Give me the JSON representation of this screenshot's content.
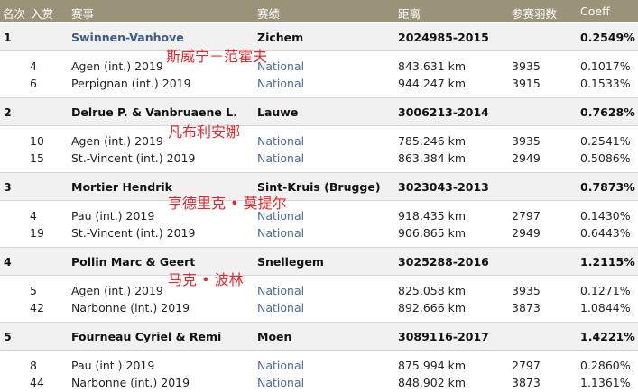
{
  "header": {
    "rank": "名次",
    "prize": "入赏",
    "race": "赛事",
    "result": "赛绩",
    "distance": "距离",
    "participants": "参赛羽数",
    "coeff": "Coeff"
  },
  "groups": [
    {
      "rank": "1",
      "name": "Swinnen-Vanhove",
      "city": "Zichem",
      "ring": "2024985-2015",
      "coeff": "0.2549%",
      "cn": "斯威宁－范霍夫",
      "rows": [
        {
          "prize": "4",
          "race": "Agen (int.) 2019",
          "result": "National",
          "distance": "843.631 km",
          "participants": "3935",
          "coeff": "0.1017%"
        },
        {
          "prize": "6",
          "race": "Perpignan (int.) 2019",
          "result": "National",
          "distance": "944.247 km",
          "participants": "3915",
          "coeff": "0.1533%"
        }
      ]
    },
    {
      "rank": "2",
      "name": "Delrue P. & Vanbruaene L.",
      "city": "Lauwe",
      "ring": "3006213-2014",
      "coeff": "0.7628%",
      "cn": "凡布利安娜",
      "rows": [
        {
          "prize": "10",
          "race": "Agen (int.) 2019",
          "result": "National",
          "distance": "785.246 km",
          "participants": "3935",
          "coeff": "0.2541%"
        },
        {
          "prize": "15",
          "race": "St.-Vincent (int.) 2019",
          "result": "National",
          "distance": "863.384 km",
          "participants": "2949",
          "coeff": "0.5086%"
        }
      ]
    },
    {
      "rank": "3",
      "name": "Mortier Hendrik",
      "city": "Sint-Kruis (Brugge)",
      "ring": "3023043-2013",
      "coeff": "0.7873%",
      "cn": "亨德里克 • 莫提尔",
      "rows": [
        {
          "prize": "4",
          "race": "Pau (int.) 2019",
          "result": "National",
          "distance": "918.435 km",
          "participants": "2797",
          "coeff": "0.1430%"
        },
        {
          "prize": "19",
          "race": "St.-Vincent (int.) 2019",
          "result": "National",
          "distance": "906.865 km",
          "participants": "2949",
          "coeff": "0.6443%"
        }
      ]
    },
    {
      "rank": "4",
      "name": "Pollin Marc & Geert",
      "city": "Snellegem",
      "ring": "3025288-2016",
      "coeff": "1.2115%",
      "cn": "马克 • 波林",
      "rows": [
        {
          "prize": "5",
          "race": "Agen (int.) 2019",
          "result": "National",
          "distance": "825.058 km",
          "participants": "3935",
          "coeff": "0.1271%"
        },
        {
          "prize": "42",
          "race": "Narbonne (int.) 2019",
          "result": "National",
          "distance": "892.666 km",
          "participants": "3873",
          "coeff": "1.0844%"
        }
      ]
    },
    {
      "rank": "5",
      "name": "Fourneau Cyriel & Remi",
      "city": "Moen",
      "ring": "3089116-2017",
      "coeff": "1.4221%",
      "cn": "",
      "rows": [
        {
          "prize": "8",
          "race": "Pau (int.) 2019",
          "result": "National",
          "distance": "875.994 km",
          "participants": "2797",
          "coeff": "0.2860%"
        },
        {
          "prize": "44",
          "race": "Narbonne (int.) 2019",
          "result": "National",
          "distance": "848.902 km",
          "participants": "3873",
          "coeff": "1.1361%"
        }
      ]
    }
  ]
}
